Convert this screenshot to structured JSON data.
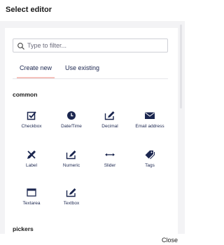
{
  "dialog": {
    "title": "Select editor",
    "close_label": "Close"
  },
  "filter": {
    "placeholder": "Type to filter..."
  },
  "tabs": [
    {
      "label": "Create new",
      "active": true
    },
    {
      "label": "Use existing",
      "active": false
    }
  ],
  "sections": {
    "common": "common",
    "pickers": "pickers"
  },
  "editors": [
    {
      "label": "Checkbox",
      "icon": "checkbox-icon"
    },
    {
      "label": "Date/Time",
      "icon": "clock-icon"
    },
    {
      "label": "Decimal",
      "icon": "edit-icon"
    },
    {
      "label": "Email address",
      "icon": "envelope-icon"
    },
    {
      "label": "Label",
      "icon": "pen-cross-icon"
    },
    {
      "label": "Numeric",
      "icon": "edit-icon"
    },
    {
      "label": "Slider",
      "icon": "horizontal-arrows-icon"
    },
    {
      "label": "Tags",
      "icon": "tags-icon"
    },
    {
      "label": "Textarea",
      "icon": "window-icon"
    },
    {
      "label": "Textbox",
      "icon": "edit-icon"
    }
  ],
  "colors": {
    "icon": "#1b264f",
    "tab_underline": "#f5c1bc",
    "panel_bg": "#f3f3f5"
  }
}
